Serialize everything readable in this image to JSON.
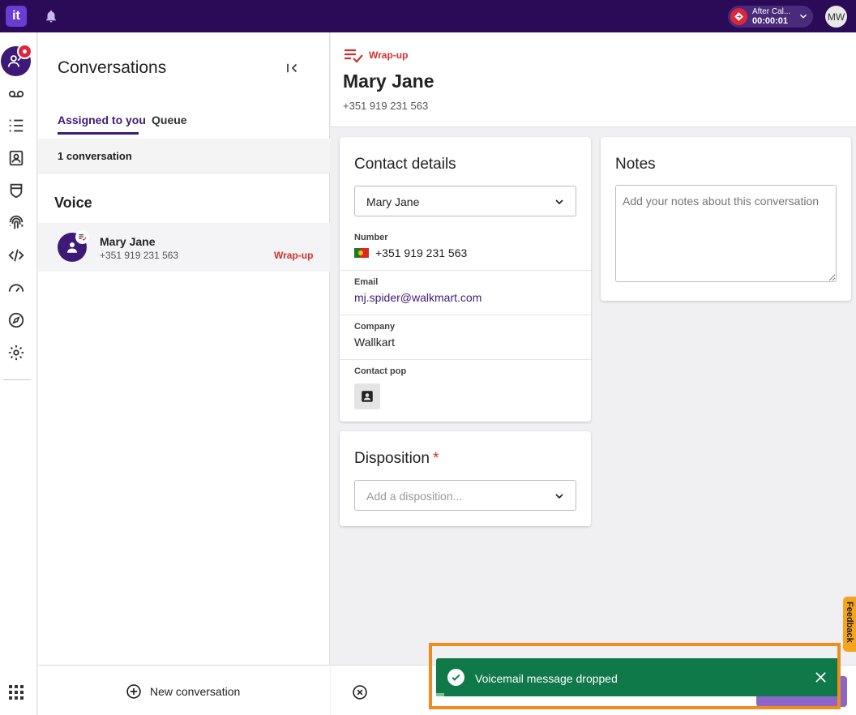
{
  "topbar": {
    "logo_text": "it",
    "status_line1": "After Cal...",
    "status_timer": "00:00:01",
    "user_initials": "MW"
  },
  "rail": {
    "icons": [
      "conversations-icon",
      "voicemail-icon",
      "list-icon",
      "contacts-icon",
      "shield-icon",
      "fingerprint-icon",
      "code-icon",
      "speedometer-icon",
      "compass-icon",
      "gear-icon",
      "apps-grid-icon"
    ]
  },
  "conversations": {
    "title": "Conversations",
    "tabs": [
      {
        "label": "Assigned to you",
        "active": true
      },
      {
        "label": "Queue",
        "active": false
      }
    ],
    "count_text": "1 conversation",
    "section": "Voice",
    "items": [
      {
        "name": "Mary Jane",
        "phone": "+351 919 231 563",
        "state": "Wrap-up"
      }
    ],
    "new_button": "New conversation"
  },
  "detail": {
    "state_label": "Wrap-up",
    "name": "Mary Jane",
    "phone": "+351 919 231 563",
    "contact_card": {
      "title": "Contact details",
      "selected_contact": "Mary Jane",
      "fields": [
        {
          "label": "Number",
          "value": "+351 919 231 563"
        },
        {
          "label": "Email",
          "value": "mj.spider@walkmart.com"
        },
        {
          "label": "Company",
          "value": "Wallkart"
        },
        {
          "label": "Contact pop",
          "value": ""
        }
      ]
    },
    "notes_card": {
      "title": "Notes",
      "placeholder": "Add your notes about this conversation"
    },
    "disposition_card": {
      "title": "Disposition",
      "required_mark": "*",
      "placeholder": "Add a disposition..."
    }
  },
  "feedback_label": "Feedback",
  "toast": {
    "message": "Voicemail message dropped"
  },
  "colors": {
    "brand": "#2b0b57",
    "accent": "#3d1a78",
    "danger": "#d32f2f",
    "success": "#10794a",
    "highlight": "#f28b1f"
  }
}
